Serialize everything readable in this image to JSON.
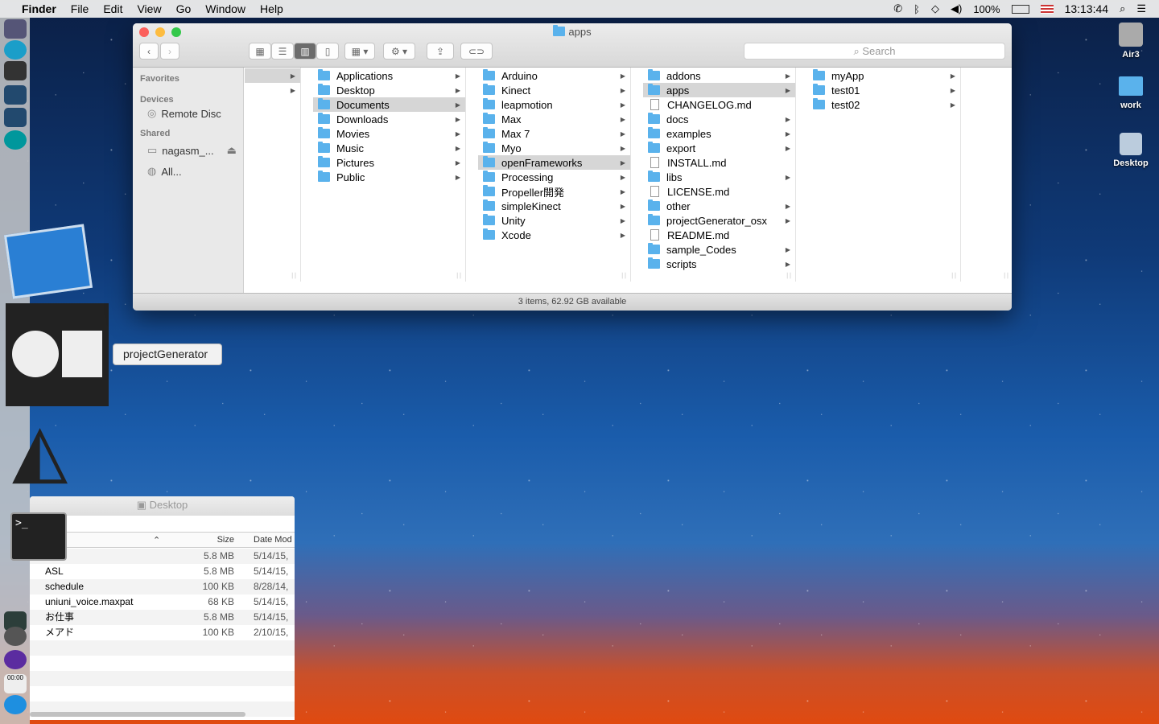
{
  "menubar": {
    "items": [
      "Finder",
      "File",
      "Edit",
      "View",
      "Go",
      "Window",
      "Help"
    ],
    "battery": "100%",
    "time": "13:13:44"
  },
  "finder": {
    "title": "apps",
    "search_placeholder": "Search",
    "status": "3 items, 62.92 GB available",
    "sidebar": {
      "favorites": "Favorites",
      "devices": "Devices",
      "remote_disc": "Remote Disc",
      "shared": "Shared",
      "nagasm": "nagasm_...",
      "all": "All..."
    },
    "columns": [
      [
        {
          "name": "",
          "folder": false,
          "arrow": true,
          "sel": true
        },
        {
          "name": "",
          "folder": false,
          "arrow": true
        }
      ],
      [
        {
          "name": "Applications",
          "folder": true,
          "arrow": true
        },
        {
          "name": "Desktop",
          "folder": true,
          "arrow": true
        },
        {
          "name": "Documents",
          "folder": true,
          "arrow": true,
          "sel": true
        },
        {
          "name": "Downloads",
          "folder": true,
          "arrow": true
        },
        {
          "name": "Movies",
          "folder": true,
          "arrow": true
        },
        {
          "name": "Music",
          "folder": true,
          "arrow": true
        },
        {
          "name": "Pictures",
          "folder": true,
          "arrow": true
        },
        {
          "name": "Public",
          "folder": true,
          "arrow": true
        }
      ],
      [
        {
          "name": "Arduino",
          "folder": true,
          "arrow": true
        },
        {
          "name": "Kinect",
          "folder": true,
          "arrow": true
        },
        {
          "name": "leapmotion",
          "folder": true,
          "arrow": true
        },
        {
          "name": "Max",
          "folder": true,
          "arrow": true
        },
        {
          "name": "Max 7",
          "folder": true,
          "arrow": true
        },
        {
          "name": "Myo",
          "folder": true,
          "arrow": true
        },
        {
          "name": "openFrameworks",
          "folder": true,
          "arrow": true,
          "sel": true
        },
        {
          "name": "Processing",
          "folder": true,
          "arrow": true
        },
        {
          "name": "Propeller開発",
          "folder": true,
          "arrow": true
        },
        {
          "name": "simpleKinect",
          "folder": true,
          "arrow": true
        },
        {
          "name": "Unity",
          "folder": true,
          "arrow": true
        },
        {
          "name": "Xcode",
          "folder": true,
          "arrow": true
        }
      ],
      [
        {
          "name": "addons",
          "folder": true,
          "arrow": true
        },
        {
          "name": "apps",
          "folder": true,
          "arrow": true,
          "sel": true
        },
        {
          "name": "CHANGELOG.md",
          "folder": false
        },
        {
          "name": "docs",
          "folder": true,
          "arrow": true
        },
        {
          "name": "examples",
          "folder": true,
          "arrow": true
        },
        {
          "name": "export",
          "folder": true,
          "arrow": true
        },
        {
          "name": "INSTALL.md",
          "folder": false
        },
        {
          "name": "libs",
          "folder": true,
          "arrow": true
        },
        {
          "name": "LICENSE.md",
          "folder": false
        },
        {
          "name": "other",
          "folder": true,
          "arrow": true
        },
        {
          "name": "projectGenerator_osx",
          "folder": true,
          "arrow": true
        },
        {
          "name": "README.md",
          "folder": false
        },
        {
          "name": "sample_Codes",
          "folder": true,
          "arrow": true
        },
        {
          "name": "scripts",
          "folder": true,
          "arrow": true
        }
      ],
      [
        {
          "name": "myApp",
          "folder": true,
          "arrow": true
        },
        {
          "name": "test01",
          "folder": true,
          "arrow": true
        },
        {
          "name": "test02",
          "folder": true,
          "arrow": true
        }
      ]
    ]
  },
  "tooltip": "projectGenerator",
  "desktop_window": {
    "title": "Desktop",
    "headers": {
      "size": "Size",
      "date": "Date Mod"
    },
    "rows": [
      {
        "name": "",
        "size": "5.8 MB",
        "date": "5/14/15,"
      },
      {
        "name": "ASL",
        "size": "5.8 MB",
        "date": "5/14/15,"
      },
      {
        "name": "schedule",
        "size": "100 KB",
        "date": "8/28/14,"
      },
      {
        "name": "uniuni_voice.maxpat",
        "size": "68 KB",
        "date": "5/14/15,"
      },
      {
        "name": "お仕事",
        "size": "5.8 MB",
        "date": "5/14/15,"
      },
      {
        "name": "メアド",
        "size": "100 KB",
        "date": "2/10/15,"
      }
    ]
  },
  "desktop_icons": [
    "Air3",
    "work",
    "Desktop"
  ],
  "dock_clock": "00:00"
}
